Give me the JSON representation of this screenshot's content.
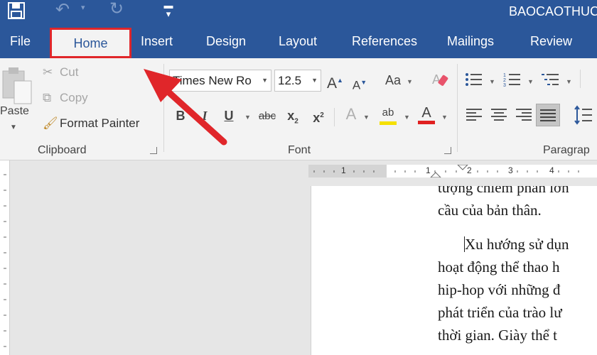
{
  "window": {
    "title": "BAOCAOTHUC"
  },
  "qat": {
    "save": "save-icon",
    "undo": "undo-icon",
    "redo": "redo-icon",
    "customize": "customize-qat-icon"
  },
  "tabs": [
    {
      "label": "File"
    },
    {
      "label": "Home",
      "active": true
    },
    {
      "label": "Insert"
    },
    {
      "label": "Design"
    },
    {
      "label": "Layout"
    },
    {
      "label": "References"
    },
    {
      "label": "Mailings"
    },
    {
      "label": "Review"
    }
  ],
  "clipboard": {
    "paste_label": "Paste",
    "cut_label": "Cut",
    "copy_label": "Copy",
    "format_painter_label": "Format Painter",
    "group_label": "Clipboard"
  },
  "font": {
    "font_name": "Times New Ro",
    "font_size": "12.5",
    "change_case_label": "Aa",
    "bold": "B",
    "italic": "I",
    "underline": "U",
    "strike": "abc",
    "subscript": "x",
    "superscript": "x",
    "sub_index": "2",
    "sup_index": "2",
    "grow_font": "A",
    "shrink_font": "A",
    "effects": "A",
    "highlight": "ab",
    "font_color": "A",
    "group_label": "Font"
  },
  "paragraph": {
    "group_label": "Paragrap"
  },
  "ruler": {
    "ticks": [
      "1",
      "1",
      "2",
      "3",
      "4"
    ]
  },
  "document": {
    "lines_p1": [
      "tượng chiếm phần lớn",
      "cầu của bản thân."
    ],
    "lines_p2": [
      "Xu hướng sử dụn",
      "hoạt động thể thao h",
      "hip-hop với những đ",
      "phát triển của trào lư",
      "thời gian. Giày thể t"
    ]
  },
  "colors": {
    "title_bar": "#2b579a",
    "annotation_red": "#e0262a",
    "highlight_yellow": "#f5e000",
    "font_color_red": "#e02020"
  }
}
